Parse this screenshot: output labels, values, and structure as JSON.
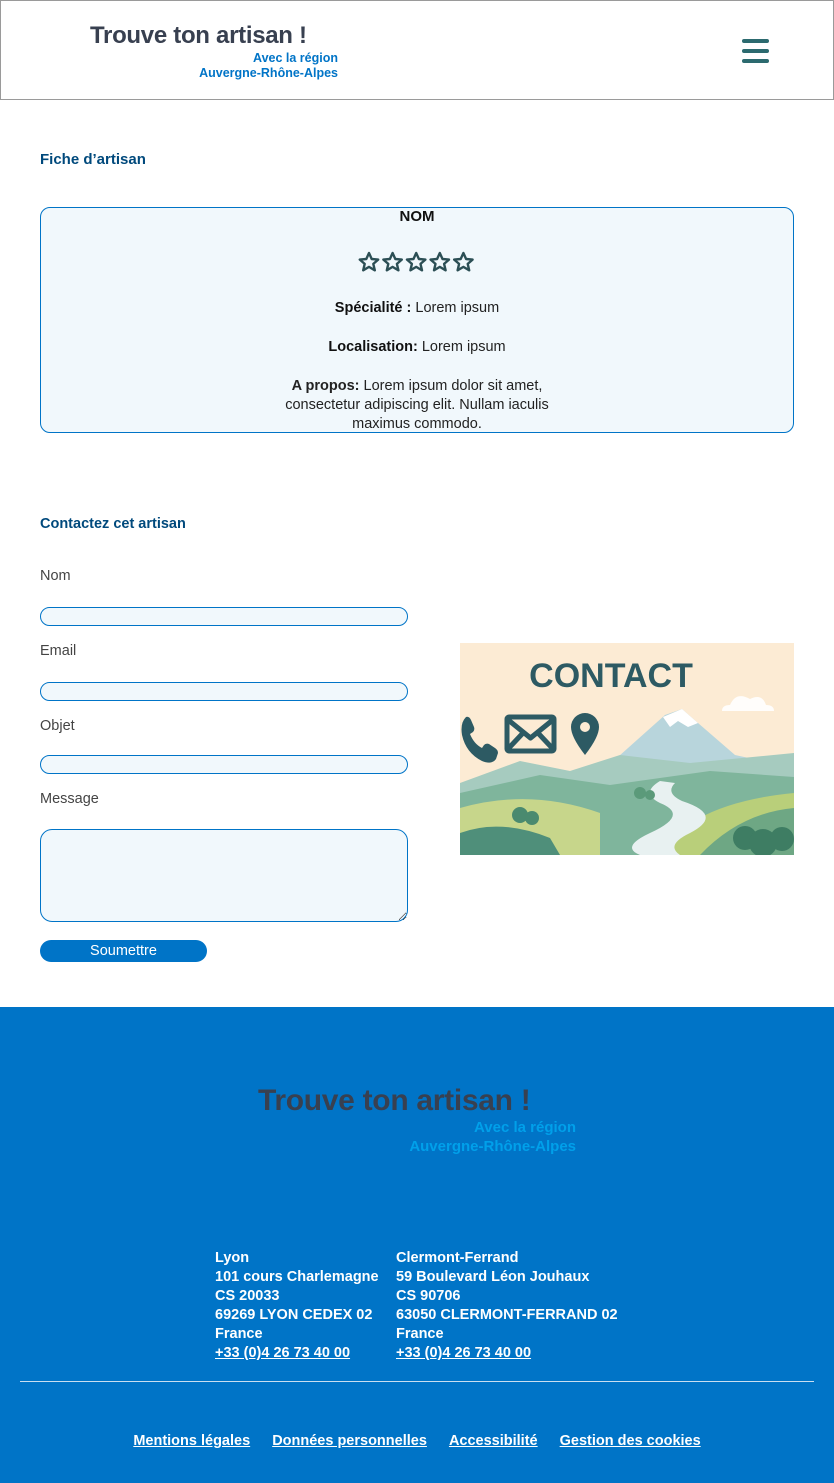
{
  "header": {
    "logo": {
      "title": "Trouve ton artisan !",
      "line2": "Avec la région",
      "line3": "Auvergne-Rhône-Alpes"
    },
    "menu_icon": "hamburger-menu-icon"
  },
  "profile": {
    "section_title": "Fiche d’artisan",
    "name": "NOM",
    "rating": {
      "filled": 0,
      "max": 5,
      "icon": "star-outline-icon"
    },
    "specialty_label": "Spécialité :",
    "specialty_value": " Lorem ipsum",
    "location_label": "Localisation:",
    "location_value": " Lorem ipsum",
    "about_label": "A propos:",
    "about_value": " Lorem ipsum dolor sit amet, consectetur adipiscing elit. Nullam iaculis maximus commodo."
  },
  "contact_form": {
    "section_title": "Contactez cet artisan",
    "name_label": "Nom",
    "email_label": "Email",
    "subject_label": "Objet",
    "message_label": "Message",
    "submit_label": "Soumettre"
  },
  "contact_image": {
    "title": "CONTACT",
    "icons": [
      "phone-icon",
      "envelope-icon",
      "map-pin-icon"
    ]
  },
  "footer": {
    "logo": {
      "title": "Trouve ton artisan !",
      "line2": "Avec la région",
      "line3": "Auvergne-Rhône-Alpes"
    },
    "offices": [
      {
        "city": "Lyon",
        "street": "101 cours Charlemagne",
        "cs": "CS 20033",
        "postal": "69269 LYON CEDEX 02",
        "country": "France",
        "phone": "+33 (0)4 26 73 40 00"
      },
      {
        "city": "Clermont-Ferrand",
        "street": "59 Boulevard Léon Jouhaux",
        "cs": "CS 90706",
        "postal": "63050 CLERMONT-FERRAND 02",
        "country": "France",
        "phone": "+33 (0)4 26 73 40 00"
      }
    ],
    "links": [
      "Mentions légales",
      "Données personnelles",
      "Accessibilité",
      "Gestion des cookies"
    ]
  },
  "colors": {
    "primary": "#0074c7",
    "dark_blue": "#00497c",
    "logo_gray": "#384050",
    "field_bg": "#f1f8fc",
    "menu_icon": "#2c6a6f"
  }
}
